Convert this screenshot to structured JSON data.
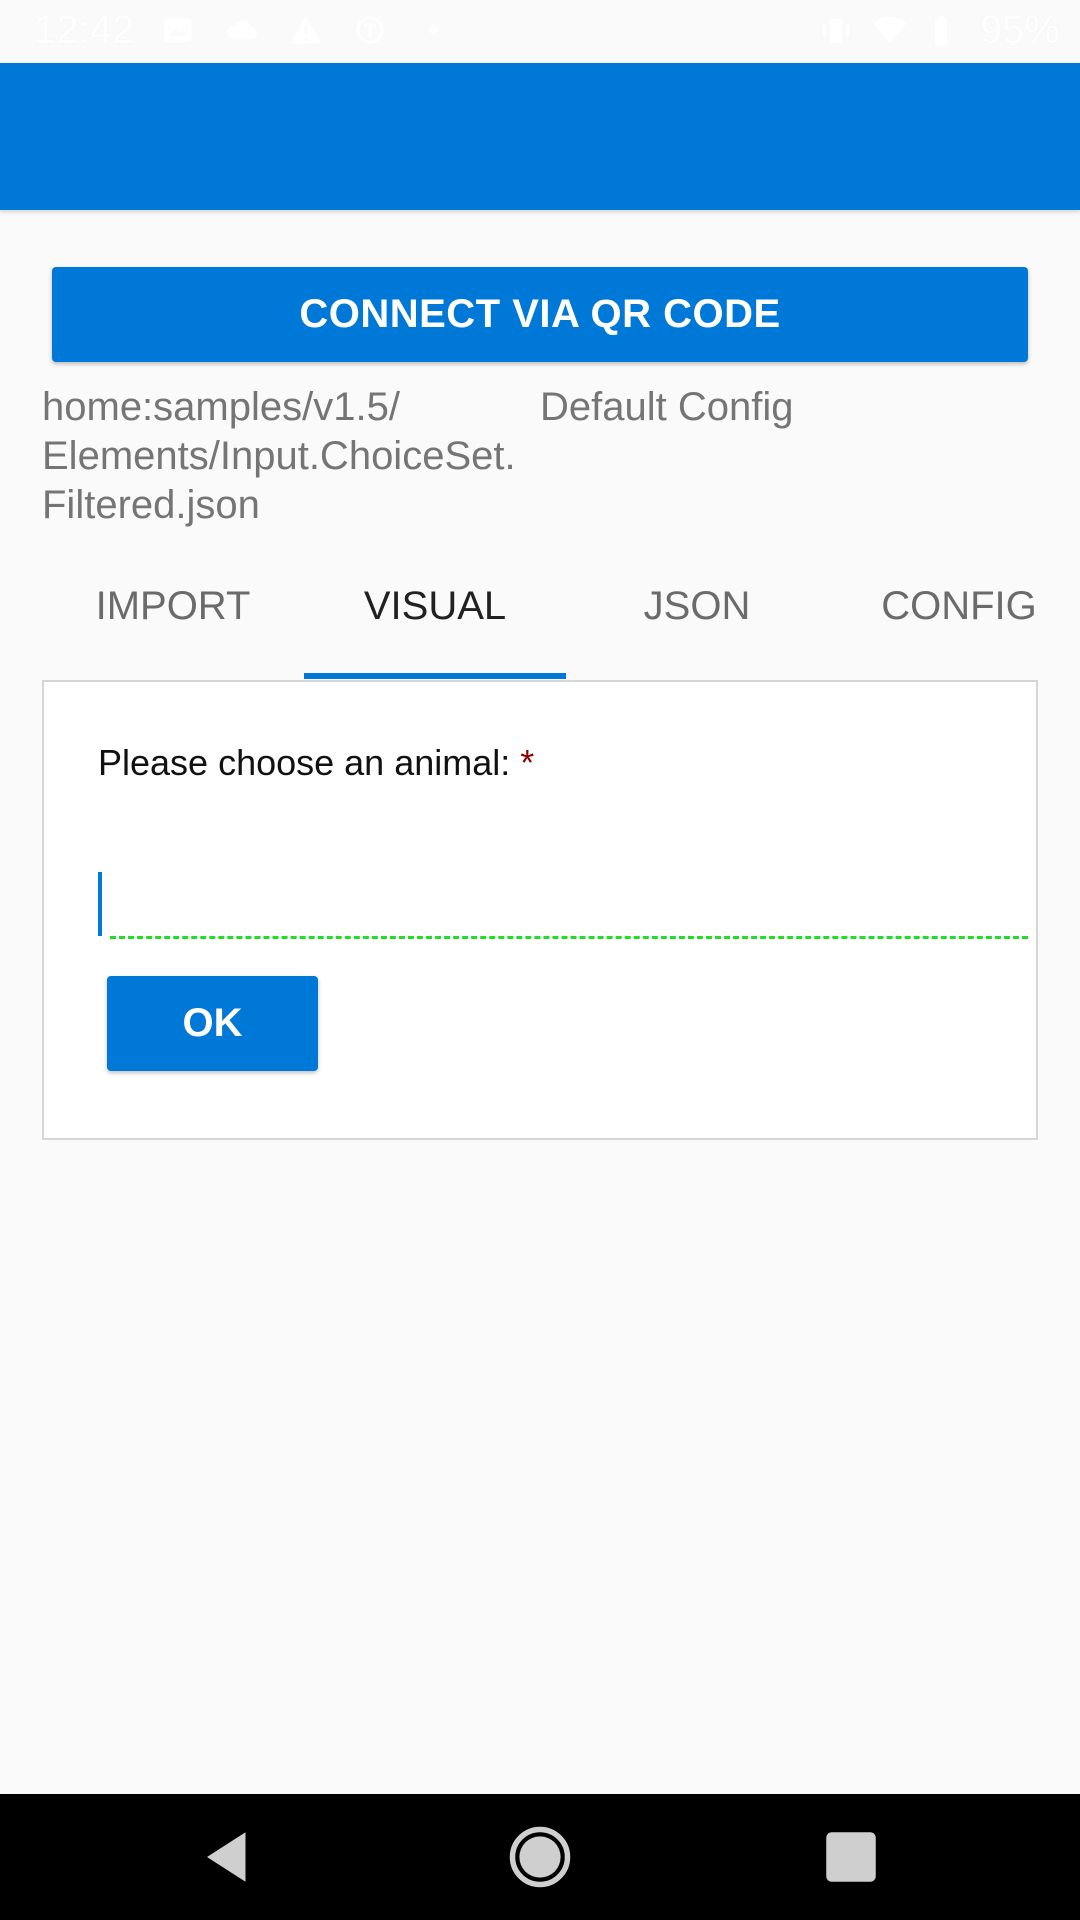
{
  "status_bar": {
    "time": "12:42",
    "battery": "95%",
    "left_icons": [
      "image-icon",
      "cloud-icon",
      "warning-icon",
      "nyt-icon",
      "dot-icon"
    ],
    "right_icons": [
      "vibrate-icon",
      "wifi-icon",
      "battery-icon"
    ]
  },
  "app_bar": {
    "color": "#0078d7"
  },
  "connect_button": {
    "label": "CONNECT VIA QR CODE"
  },
  "file_path": "home:samples/v1.5/\nElements/Input.ChoiceSet.\nFiltered.json",
  "config_name": "Default Config",
  "tabs": [
    {
      "label": "IMPORT",
      "active": false
    },
    {
      "label": "VISUAL",
      "active": true
    },
    {
      "label": "JSON",
      "active": false
    },
    {
      "label": "CONFIG",
      "active": false
    }
  ],
  "card": {
    "choice_label": "Please choose an animal:",
    "required_marker": "*",
    "input_value": "",
    "ok_label": "OK"
  },
  "nav_bar": {
    "buttons": [
      "back-icon",
      "home-icon",
      "recents-icon"
    ]
  },
  "colors": {
    "accent": "#0078d7",
    "required": "#8b0000",
    "input_underline": "#22dd22"
  }
}
